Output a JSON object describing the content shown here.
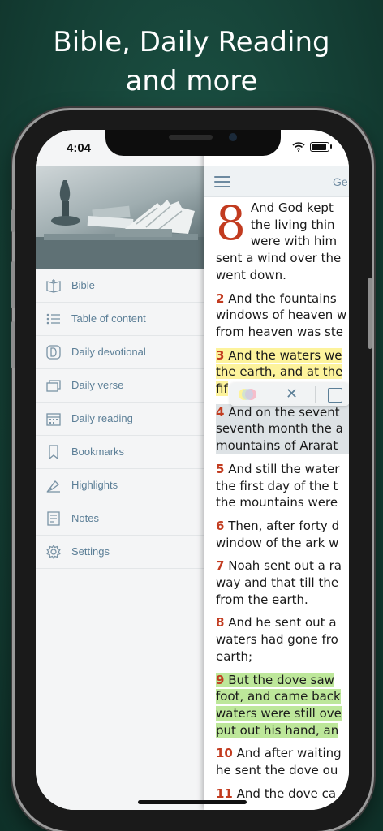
{
  "headline": {
    "line1": "Bible, Daily Reading",
    "line2": "and more"
  },
  "status": {
    "time": "4:04"
  },
  "sidebar": {
    "items": [
      {
        "label": "Bible",
        "icon": "book-open-icon"
      },
      {
        "label": "Table of content",
        "icon": "list-icon"
      },
      {
        "label": "Daily devotional",
        "icon": "devotional-d-icon"
      },
      {
        "label": "Daily verse",
        "icon": "verse-cards-icon"
      },
      {
        "label": "Daily reading",
        "icon": "calendar-icon"
      },
      {
        "label": "Bookmarks",
        "icon": "bookmark-icon"
      },
      {
        "label": "Highlights",
        "icon": "highlighter-icon"
      },
      {
        "label": "Notes",
        "icon": "notes-icon"
      },
      {
        "label": "Settings",
        "icon": "gear-icon"
      }
    ]
  },
  "reader": {
    "book_label": "Ge",
    "chapter_number": "8",
    "verse1": {
      "l1": "And God kept",
      "l2": "the living thin",
      "l3": "were with him",
      "l4": "sent a wind over the",
      "l5": "went down."
    },
    "verse2": {
      "num": "2",
      "l1": "And the fountains",
      "l2": "windows of heaven w",
      "l3": "from heaven was ste"
    },
    "verse3": {
      "num": "3",
      "l1": "And the waters we",
      "l2": "the earth, and at the",
      "l3": "fif"
    },
    "verse4": {
      "num": "4",
      "l1": "And on the sevent",
      "l2": "seventh month the a",
      "l3": "mountains of Ararat"
    },
    "verse5": {
      "num": "5",
      "l1": "And still the water",
      "l2": "the first day of the t",
      "l3": "the mountains were"
    },
    "verse6": {
      "num": "6",
      "l1": "Then, after forty d",
      "l2": "window of the ark w"
    },
    "verse7": {
      "num": "7",
      "l1": "Noah sent out a ra",
      "l2": "way and that till the",
      "l3": "from the earth."
    },
    "verse8": {
      "num": "8",
      "l1": "And he sent out a",
      "l2": "waters had gone fro",
      "l3": "earth;"
    },
    "verse9": {
      "num": "9",
      "l1": "But the dove saw",
      "l2": "foot, and came back",
      "l3": "waters were still ove",
      "l4": "put out his hand, an"
    },
    "verse10": {
      "num": "10",
      "l1": "And after waiting",
      "l2": "he sent the dove ou"
    },
    "verse11": {
      "num": "11",
      "l1": "And the dove ca"
    }
  },
  "colors": {
    "background": "#164338",
    "accent": "#c23b1f",
    "sidebar_text": "#5c7f97",
    "highlight_yellow": "#fdf39c",
    "highlight_green": "#bde79a"
  }
}
